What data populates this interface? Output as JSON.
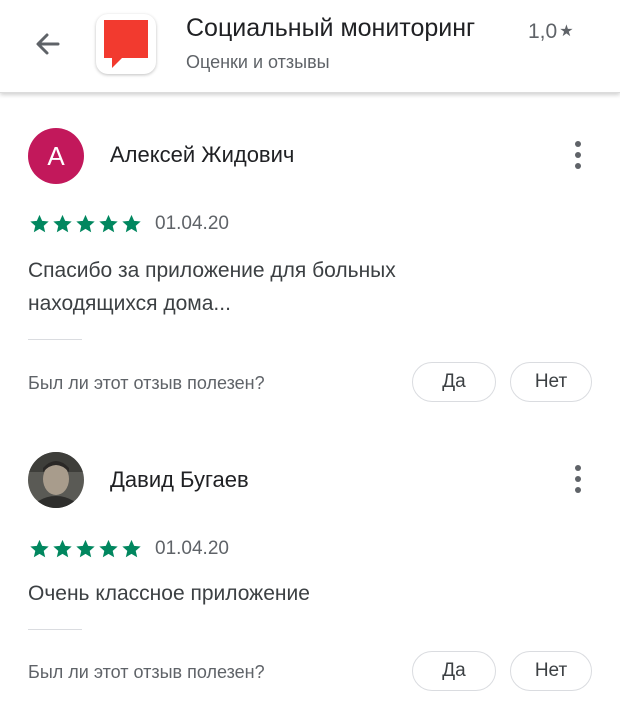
{
  "header": {
    "app_title": "Социальный мониторинг",
    "rating": "1,0",
    "subtitle": "Оценки и отзывы",
    "app_icon_color": "#f23a2f"
  },
  "reviews": [
    {
      "author": "Алексей Жидович",
      "avatar_letter": "А",
      "avatar_color": "#c2185b",
      "stars": 5,
      "date": "01.04.20",
      "text_line1": "Спасибо за приложение для больных",
      "text_line2": "находящихся дома...",
      "helpful_question": "Был ли этот отзыв полезен?",
      "yes_label": "Да",
      "no_label": "Нет"
    },
    {
      "author": "Давид Бугаев",
      "avatar_letter": "",
      "stars": 5,
      "date": "01.04.20",
      "text_line1": "Очень классное приложение",
      "helpful_question": "Был ли этот отзыв полезен?",
      "yes_label": "Да",
      "no_label": "Нет"
    }
  ],
  "colors": {
    "star_green": "#01875f",
    "icon_grey": "#5f6368"
  }
}
